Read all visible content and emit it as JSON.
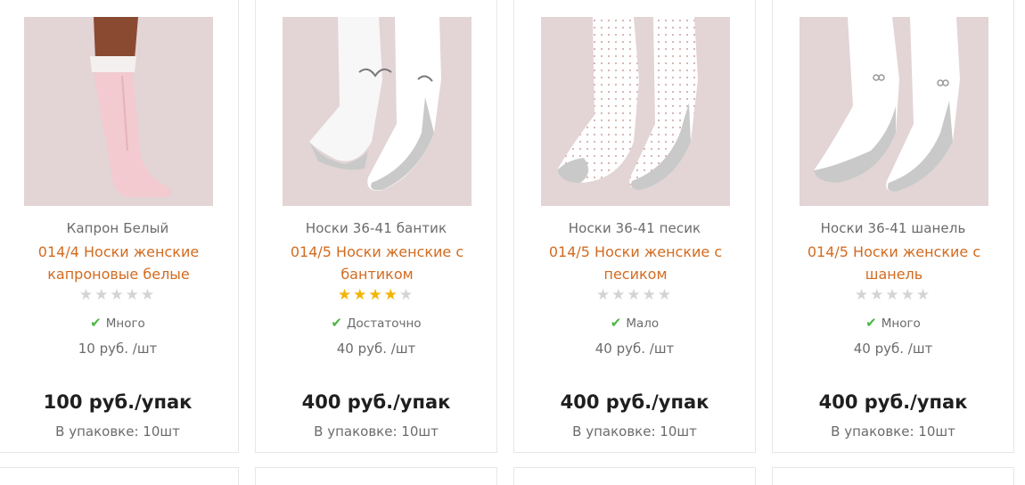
{
  "products": [
    {
      "subtitle": "Капрон Белый",
      "title": "014/4 Носки женские капроновые белые",
      "rating": 0,
      "stock": "Много",
      "unit_price": "10 руб. /шт",
      "pack_price": "100 руб./упак",
      "pack_qty": "В упаковке: 10шт",
      "image_icon": "sock-image"
    },
    {
      "subtitle": "Носки 36-41 бантик",
      "title": "014/5 Носки женские с бантиком",
      "rating": 4,
      "stock": "Достаточно",
      "unit_price": "40 руб. /шт",
      "pack_price": "400 руб./упак",
      "pack_qty": "В упаковке: 10шт",
      "image_icon": "sock-image"
    },
    {
      "subtitle": "Носки 36-41 песик",
      "title": "014/5 Носки женские с песиком",
      "rating": 0,
      "stock": "Мало",
      "unit_price": "40 руб. /шт",
      "pack_price": "400 руб./упак",
      "pack_qty": "В упаковке: 10шт",
      "image_icon": "sock-image"
    },
    {
      "subtitle": "Носки 36-41 шанель",
      "title": "014/5 Носки женские с шанель",
      "rating": 0,
      "stock": "Много",
      "unit_price": "40 руб. /шт",
      "pack_price": "400 руб./упак",
      "pack_qty": "В упаковке: 10шт",
      "image_icon": "sock-image"
    }
  ],
  "colors": {
    "title": "#d26b20",
    "star_on": "#f4b400",
    "star_off": "#d4d4d4",
    "check": "#4bb643",
    "image_bg": "#e3d4d6"
  }
}
